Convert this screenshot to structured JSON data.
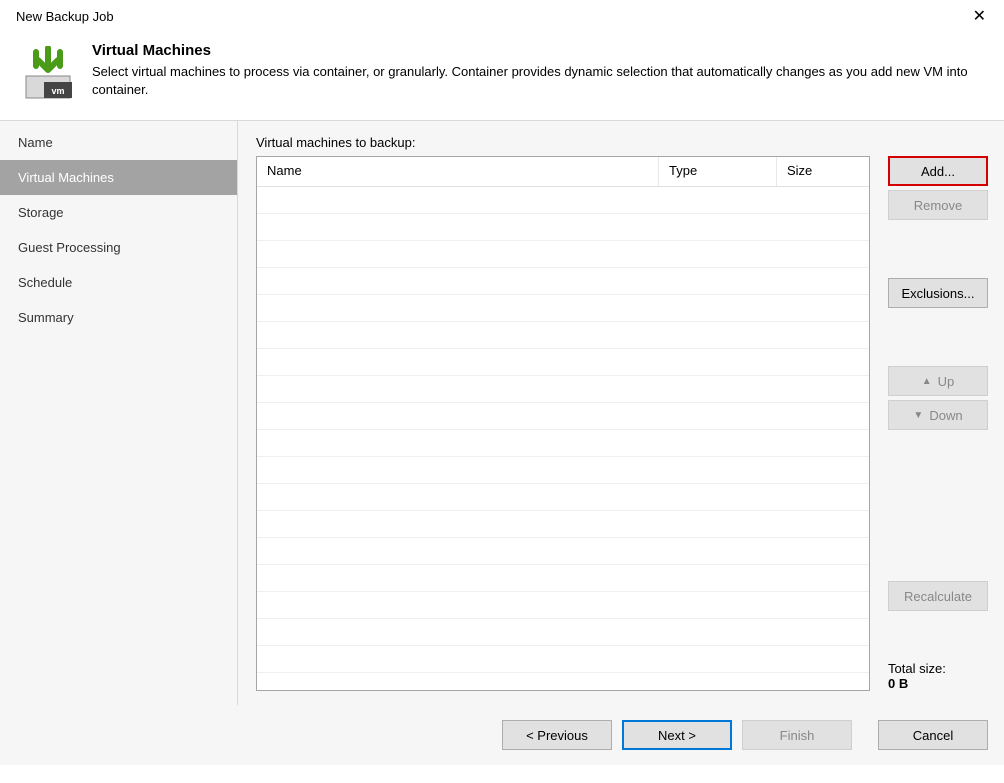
{
  "window": {
    "title": "New Backup Job"
  },
  "header": {
    "title": "Virtual Machines",
    "description": "Select virtual machines to process via container, or granularly. Container provides dynamic selection that automatically changes as you add new VM into container."
  },
  "sidebar": {
    "items": [
      {
        "label": "Name",
        "selected": false
      },
      {
        "label": "Virtual Machines",
        "selected": true
      },
      {
        "label": "Storage",
        "selected": false
      },
      {
        "label": "Guest Processing",
        "selected": false
      },
      {
        "label": "Schedule",
        "selected": false
      },
      {
        "label": "Summary",
        "selected": false
      }
    ]
  },
  "main": {
    "list_label": "Virtual machines to backup:",
    "columns": {
      "name": "Name",
      "type": "Type",
      "size": "Size"
    }
  },
  "buttons": {
    "add": "Add...",
    "remove": "Remove",
    "exclusions": "Exclusions...",
    "up": "Up",
    "down": "Down",
    "recalculate": "Recalculate"
  },
  "total": {
    "label": "Total size:",
    "value": "0 B"
  },
  "footer": {
    "previous": "< Previous",
    "next": "Next >",
    "finish": "Finish",
    "cancel": "Cancel"
  }
}
